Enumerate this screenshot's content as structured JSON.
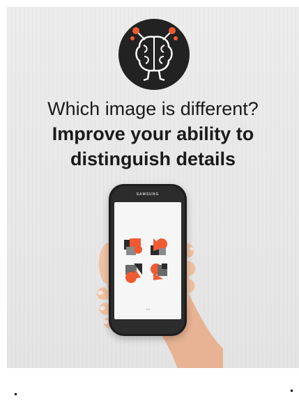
{
  "headline": {
    "line1": "Which image is different?",
    "line2": "Improve your ability to",
    "line3": "distinguish details"
  },
  "phone": {
    "brand": "SAMSUNG",
    "counter": "1/3"
  },
  "logo": {
    "icon": "brain-icon"
  },
  "colors": {
    "accent": "#f05a32",
    "dark": "#222222",
    "background": "#e8e8e8"
  }
}
